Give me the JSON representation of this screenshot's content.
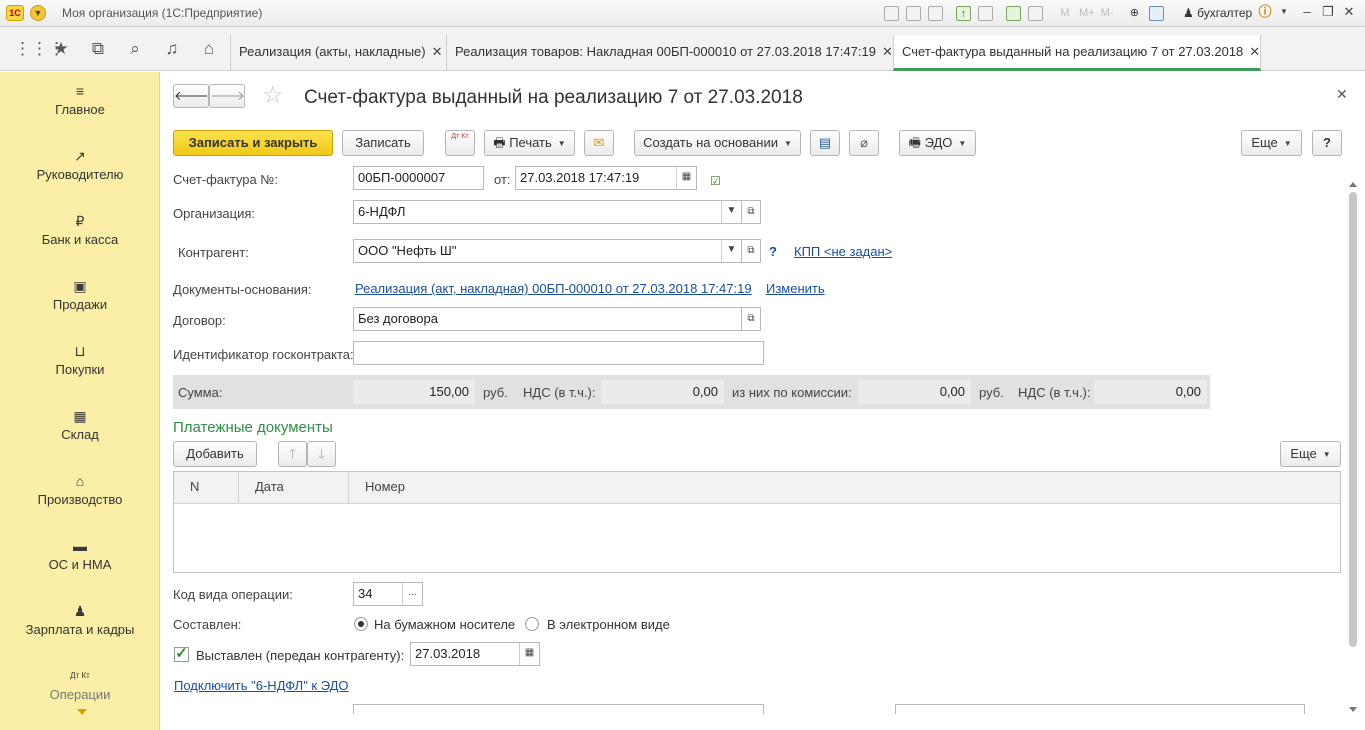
{
  "window": {
    "app_title": "Моя организация  (1С:Предприятие)",
    "user": "бухгалтер",
    "logo_text": "1С"
  },
  "tabs": [
    {
      "label": "Реализация (акты, накладные)"
    },
    {
      "label": "Реализация товаров: Накладная 00БП-000010 от 27.03.2018 17:47:19"
    },
    {
      "label": "Счет-фактура выданный на реализацию 7 от 27.03.2018"
    }
  ],
  "sidebar": {
    "items": [
      {
        "label": "Главное",
        "icon": "menu-icon"
      },
      {
        "label": "Руководителю",
        "icon": "chart-icon"
      },
      {
        "label": "Банк и касса",
        "icon": "ruble-icon"
      },
      {
        "label": "Продажи",
        "icon": "bag-icon"
      },
      {
        "label": "Покупки",
        "icon": "cart-icon"
      },
      {
        "label": "Склад",
        "icon": "grid-icon"
      },
      {
        "label": "Производство",
        "icon": "factory-icon"
      },
      {
        "label": "ОС и НМА",
        "icon": "truck-icon"
      },
      {
        "label": "Зарплата и кадры",
        "icon": "person-icon"
      },
      {
        "label": "Операции",
        "icon": "dtkt-icon"
      }
    ]
  },
  "form": {
    "title": "Счет-фактура выданный на реализацию 7 от 27.03.2018",
    "toolbar": {
      "save_close": "Записать и закрыть",
      "save": "Записать",
      "dtkt": "Дт Кт",
      "print": "Печать",
      "create_based": "Создать на основании",
      "edo": "ЭДО",
      "more": "Еще",
      "help": "?"
    },
    "invoice_number_label": "Счет-фактура №:",
    "invoice_number": "00БП-0000007",
    "date_label": "от:",
    "date": "27.03.2018 17:47:19",
    "org_label": "Организация:",
    "org": "6-НДФЛ",
    "contractor_label": "Контрагент:",
    "contractor": "ООО \"Нефть Ш\"",
    "contractor_help": "?",
    "kpp_link": "КПП <не задан>",
    "basis_label": "Документы-основания:",
    "basis_link": "Реализация (акт, накладная) 00БП-000010 от 27.03.2018 17:47:19",
    "basis_change": "Изменить",
    "contract_label": "Договор:",
    "contract": "Без договора",
    "gov_contract_label": "Идентификатор госконтракта:",
    "gov_contract": ""
  },
  "summary": {
    "sum_label": "Сумма:",
    "sum": "150,00",
    "currency1": "руб.",
    "vat_label": "НДС (в т.ч.):",
    "vat": "0,00",
    "commission_label": "из них по комиссии:",
    "commission": "0,00",
    "currency2": "руб.",
    "vat2_label": "НДС (в т.ч.):",
    "vat2": "0,00"
  },
  "payments": {
    "title": "Платежные документы",
    "add": "Добавить",
    "more": "Еще",
    "columns": [
      "N",
      "Дата",
      "Номер"
    ],
    "rows": []
  },
  "bottom": {
    "op_code_label": "Код вида операции:",
    "op_code": "34",
    "op_code_btn": "...",
    "composed_label": "Составлен:",
    "paper": "На бумажном носителе",
    "electronic": "В электронном виде",
    "composed_selected": "paper",
    "issued_label": "Выставлен (передан контрагенту):",
    "issued_checked": true,
    "issued_date": "27.03.2018",
    "edo_link": "Подключить \"6-НДФЛ\" к ЭДО"
  },
  "colors": {
    "sidebar_bg": "#fbeea7",
    "primary_button": "#f5d327",
    "section_title": "#2f8f44",
    "link": "#1a4fa0",
    "active_tab_underline": "#3d9c57"
  }
}
